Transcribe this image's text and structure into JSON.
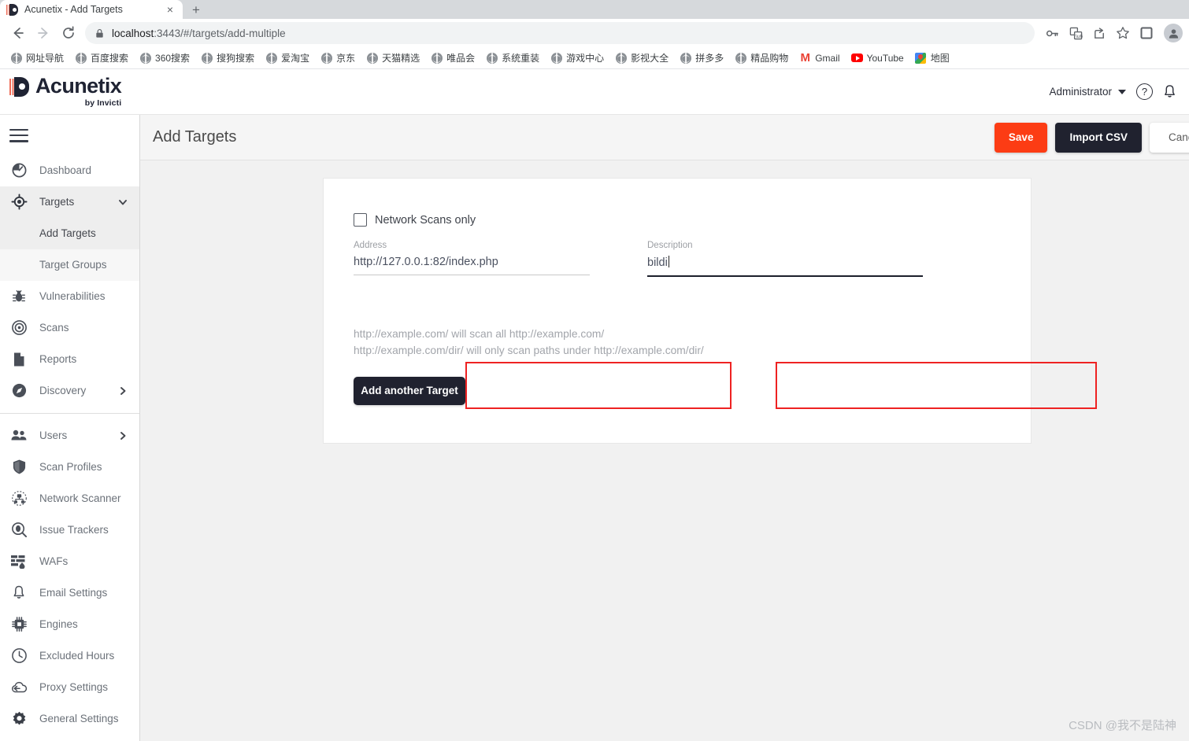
{
  "browser": {
    "tab": {
      "title": "Acunetix - Add Targets",
      "favicon": "acunetix-favicon",
      "close": "×"
    },
    "newtab_label": "+",
    "nav": {
      "back": "back-arrow",
      "forward": "forward-arrow",
      "reload": "reload-icon"
    },
    "omnibox": {
      "lock": "lock-icon",
      "host": "localhost",
      "path": ":3443/#/targets/add-multiple",
      "full_url": "localhost:3443/#/targets/add-multiple"
    },
    "toolbar_icons": [
      "key-icon",
      "translate-icon",
      "share-icon",
      "star-icon",
      "sidebar-panel-icon",
      "profile-avatar-icon"
    ],
    "bookmarks": [
      {
        "label": "网址导航",
        "icon": "globe-icon"
      },
      {
        "label": "百度搜索",
        "icon": "globe-icon"
      },
      {
        "label": "360搜索",
        "icon": "globe-icon"
      },
      {
        "label": "搜狗搜索",
        "icon": "globe-icon"
      },
      {
        "label": "爱淘宝",
        "icon": "globe-icon"
      },
      {
        "label": "京东",
        "icon": "globe-icon"
      },
      {
        "label": "天猫精选",
        "icon": "globe-icon"
      },
      {
        "label": "唯品会",
        "icon": "globe-icon"
      },
      {
        "label": "系统重装",
        "icon": "globe-icon"
      },
      {
        "label": "游戏中心",
        "icon": "globe-icon"
      },
      {
        "label": "影视大全",
        "icon": "globe-icon"
      },
      {
        "label": "拼多多",
        "icon": "globe-icon"
      },
      {
        "label": "精品购物",
        "icon": "globe-icon"
      },
      {
        "label": "Gmail",
        "icon": "gmail-icon"
      },
      {
        "label": "YouTube",
        "icon": "youtube-icon"
      },
      {
        "label": "地图",
        "icon": "google-maps-icon"
      }
    ]
  },
  "app_header": {
    "brand": "Acunetix",
    "brand_sub": "by Invicti",
    "user": "Administrator",
    "help_icon": "?",
    "notification_icon": "bell-icon"
  },
  "sidebar": {
    "items": [
      {
        "label": "Dashboard",
        "icon": "dashboard-gauge-icon",
        "state": "normal",
        "chevron": null
      },
      {
        "label": "Targets",
        "icon": "target-crosshair-icon",
        "state": "active",
        "chevron": "down"
      },
      {
        "label": "Add Targets",
        "icon": null,
        "state": "sub-active",
        "chevron": null
      },
      {
        "label": "Target Groups",
        "icon": null,
        "state": "sub-light",
        "chevron": null
      },
      {
        "label": "Vulnerabilities",
        "icon": "bug-icon",
        "state": "normal",
        "chevron": null
      },
      {
        "label": "Scans",
        "icon": "radar-icon",
        "state": "normal",
        "chevron": null
      },
      {
        "label": "Reports",
        "icon": "document-icon",
        "state": "normal",
        "chevron": null
      },
      {
        "label": "Discovery",
        "icon": "compass-icon",
        "state": "normal",
        "chevron": "right"
      }
    ],
    "items2": [
      {
        "label": "Users",
        "icon": "users-icon",
        "state": "normal",
        "chevron": "right"
      },
      {
        "label": "Scan Profiles",
        "icon": "shield-icon",
        "state": "normal",
        "chevron": null
      },
      {
        "label": "Network Scanner",
        "icon": "network-scanner-icon",
        "state": "normal",
        "chevron": null
      },
      {
        "label": "Issue Trackers",
        "icon": "issue-tracker-magnifier-icon",
        "state": "normal",
        "chevron": null
      },
      {
        "label": "WAFs",
        "icon": "waf-firewall-icon",
        "state": "normal",
        "chevron": null
      },
      {
        "label": "Email Settings",
        "icon": "bell-icon",
        "state": "normal",
        "chevron": null
      },
      {
        "label": "Engines",
        "icon": "chip-icon",
        "state": "normal",
        "chevron": null
      },
      {
        "label": "Excluded Hours",
        "icon": "clock-icon",
        "state": "normal",
        "chevron": null
      },
      {
        "label": "Proxy Settings",
        "icon": "cloud-proxy-icon",
        "state": "normal",
        "chevron": null
      },
      {
        "label": "General Settings",
        "icon": "gear-icon",
        "state": "normal",
        "chevron": null
      }
    ]
  },
  "content": {
    "page_title": "Add Targets",
    "buttons": {
      "save": "Save",
      "import_csv": "Import CSV",
      "cancel": "Cancel"
    },
    "checkbox": {
      "label": "Network Scans only",
      "checked": false
    },
    "address_field": {
      "label": "Address",
      "value": "http://127.0.0.1:82/index.php",
      "focused": false
    },
    "description_field": {
      "label": "Description",
      "value": "bildi",
      "focused": true
    },
    "hints": {
      "line1": "http://example.com/ will scan all http://example.com/",
      "line2": "http://example.com/dir/ will only scan paths under http://example.com/dir/"
    },
    "add_another": "Add another Target"
  },
  "watermark": "CSDN @我不是陆神",
  "colors": {
    "save_button": "#fc3c14",
    "dark_button": "#20222f",
    "highlight_box": "#ee2222",
    "sidebar_active": "#eeeeee",
    "content_bg": "#f1f1f1"
  }
}
